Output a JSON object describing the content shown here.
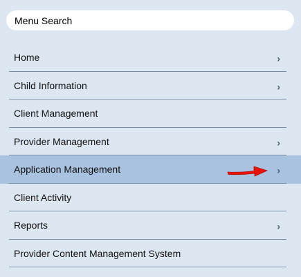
{
  "search": {
    "placeholder": "Menu Search"
  },
  "menu": {
    "items": [
      {
        "label": "Home",
        "has_submenu": true,
        "chevron": "›"
      },
      {
        "label": "Child Information",
        "has_submenu": true,
        "chevron": "›"
      },
      {
        "label": "Client Management",
        "has_submenu": false
      },
      {
        "label": "Provider Management",
        "has_submenu": true,
        "chevron": "›"
      },
      {
        "label": "Application Management",
        "has_submenu": true,
        "chevron": "›",
        "selected": true
      },
      {
        "label": "Client Activity",
        "has_submenu": false
      },
      {
        "label": "Reports",
        "has_submenu": true,
        "chevron": "›"
      },
      {
        "label": "Provider Content Management System",
        "has_submenu": false
      }
    ]
  },
  "colors": {
    "panel_bg": "#dde7f1",
    "selected_bg": "#a9c2df",
    "divider": "#7b8ea7",
    "annotation_arrow": "#e8140c"
  },
  "icons": {
    "chevron": "chevron-right-icon",
    "annotation": "red-arrow-annotation"
  }
}
